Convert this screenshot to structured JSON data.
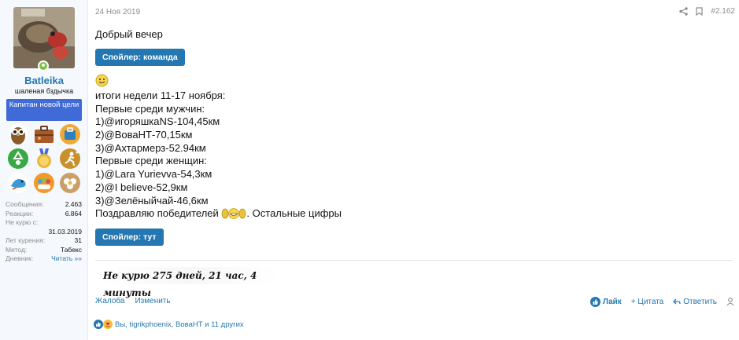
{
  "post": {
    "date": "24 Ноя 2019",
    "number": "#2.162"
  },
  "user": {
    "name": "Batleika",
    "title": "шаленая бздычка",
    "banner": "Капитан новой цели",
    "trophies": [
      "owl-icon",
      "suitcase-icon",
      "baggage-icon",
      "recycle-icon",
      "medal-icon",
      "runner-icon",
      "bird-icon",
      "crowd-icon",
      "flower-icon"
    ],
    "stats": {
      "messages_label": "Сообщения:",
      "messages_value": "2.463",
      "reactions_label": "Реакции:",
      "reactions_value": "6.864",
      "quit_label": "Не курю с:",
      "quit_value": "31.03.2019",
      "years_label": "Лет курения:",
      "years_value": "31",
      "method_label": "Метод:",
      "method_value": "Табекс",
      "diary_label": "Дневник:",
      "diary_value": "Читать »»"
    }
  },
  "content": {
    "greeting": "Добрый вечер",
    "spoiler1": "Спойлер: команда",
    "lines": [
      "итоги недели 11-17 ноября:",
      "Первые среди мужчин:",
      "1)@игоряшкаNS-104,45км",
      "2)@ВоваНТ-70,15км",
      "3)@Ахтармерз-52.94км",
      "Первые среди женщин:",
      "1)@Lara Yurievva-54,3км",
      "2)@I believe-52,9км",
      "3)@Зелёныйчай-46,6км"
    ],
    "congrats_prefix": "Поздравляю победителей",
    "congrats_suffix": ". Остальные цифры",
    "spoiler2": "Спойлер: тут",
    "signature": "Не курю  275 дней, 21 час, 4 минуты"
  },
  "footer": {
    "report": "Жалоба",
    "edit": "Изменить",
    "like": "Лайк",
    "quote": "+ Цитата",
    "reply": "Ответить"
  },
  "reactions": {
    "text": "Вы, tigrikphoenix, ВоваНТ и 11 других"
  },
  "colors": {
    "link": "#2577b1",
    "banner": "#3f6ad8",
    "online": "#7ac143"
  }
}
